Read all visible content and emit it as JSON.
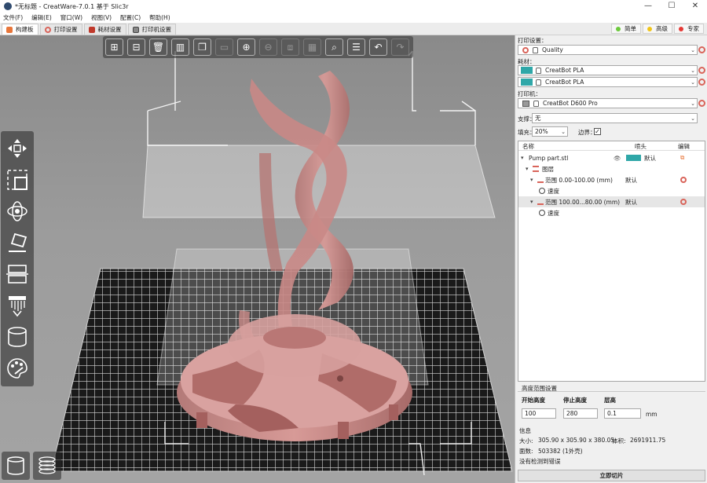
{
  "window": {
    "title": "*无标题 - CreatWare-7.0.1 基于 Slic3r",
    "minimize": "—",
    "maximize": "☐",
    "close": "✕"
  },
  "menu": [
    "文件(F)",
    "编辑(E)",
    "窗口(W)",
    "视图(V)",
    "配置(C)",
    "帮助(H)"
  ],
  "tabs": [
    {
      "label": "构建板",
      "active": true
    },
    {
      "label": "打印设置",
      "active": false
    },
    {
      "label": "耗材设置",
      "active": false
    },
    {
      "label": "打印机设置",
      "active": false
    }
  ],
  "modes": [
    {
      "label": "简单",
      "color": "#6cc93c"
    },
    {
      "label": "高级",
      "color": "#f0c419"
    },
    {
      "label": "专家",
      "color": "#e53935"
    }
  ],
  "panel": {
    "print_settings_label": "打印设置：",
    "print_settings_value": "Quality",
    "filament_label": "耗材：",
    "filaments": [
      "CreatBot PLA",
      "CreatBot PLA"
    ],
    "filament_color": "#2fa7a8",
    "printer_label": "打印机：",
    "printer_value": "CreatBot D600 Pro",
    "support_label": "支撑：",
    "support_value": "无",
    "infill_label": "填充：",
    "infill_value": "20%",
    "brim_label": "边界：",
    "brim_checked": "✓",
    "tree": {
      "col_name": "名称",
      "col_extruder": "喷头",
      "col_edit": "编辑",
      "object_name": "Pump part.stl",
      "object_extruder": "默认",
      "layers_label": "图层",
      "ranges": [
        {
          "label": "范围 0.00-100.00 (mm)",
          "extruder": "默认",
          "child": "速度"
        },
        {
          "label": "范围 100.00...80.00 (mm)",
          "extruder": "默认",
          "child": "速度"
        }
      ]
    },
    "range_settings": {
      "title": "高度范围设置",
      "start_label": "开始高度",
      "stop_label": "停止高度",
      "layer_label": "层高",
      "start_value": "100",
      "stop_value": "280",
      "layer_value": "0.1",
      "unit": "mm"
    },
    "info": {
      "title": "信息",
      "size_label": "大小:",
      "size_value": "305.90 x 305.90 x 380.05",
      "volume_label": "体积:",
      "volume_value": "2691911.75",
      "facets_label": "面数:",
      "facets_value": "503382 (1外壳)",
      "errors_text": "没有检测到错误"
    },
    "slice_button": "立即切片"
  }
}
